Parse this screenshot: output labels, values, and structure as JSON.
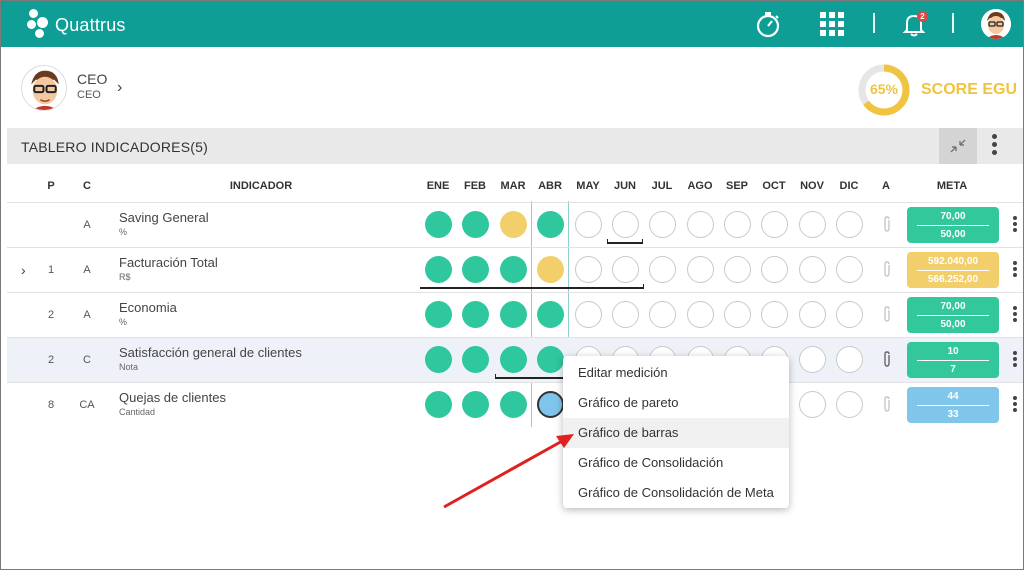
{
  "app": {
    "name": "Quattrus",
    "notification_count": "2"
  },
  "profile": {
    "name": "CEO",
    "role": "CEO"
  },
  "score": {
    "percent": "65%",
    "label": "SCORE EGU",
    "value": 0.65,
    "color": "#f0c341"
  },
  "board": {
    "title": "TABLERO INDICADORES(5)"
  },
  "table": {
    "headers": {
      "p": "P",
      "c": "C",
      "indicador": "INDICADOR",
      "a": "A",
      "meta": "META"
    },
    "months": [
      "ENE",
      "FEB",
      "MAR",
      "ABR",
      "MAY",
      "JUN",
      "JUL",
      "AGO",
      "SEP",
      "OCT",
      "NOV",
      "DIC"
    ],
    "rows": [
      {
        "p": "",
        "c": "A",
        "name": "Saving General",
        "unit": "%",
        "meta_top": "70,00",
        "meta_bottom": "50,00",
        "meta_color": "green",
        "statuses": [
          "green",
          "green",
          "yellow",
          "green",
          "empty",
          "empty",
          "empty",
          "empty",
          "empty",
          "empty",
          "empty",
          "empty"
        ]
      },
      {
        "p": "1",
        "c": "A",
        "name": "Facturación Total",
        "unit": "R$",
        "meta_top": "592.040,00",
        "meta_bottom": "566.252,00",
        "meta_color": "yellow",
        "statuses": [
          "green",
          "green",
          "green",
          "yellow",
          "empty",
          "empty",
          "empty",
          "empty",
          "empty",
          "empty",
          "empty",
          "empty"
        ]
      },
      {
        "p": "2",
        "c": "A",
        "name": "Economia",
        "unit": "%",
        "meta_top": "70,00",
        "meta_bottom": "50,00",
        "meta_color": "green",
        "statuses": [
          "green",
          "green",
          "green",
          "green",
          "empty",
          "empty",
          "empty",
          "empty",
          "empty",
          "empty",
          "empty",
          "empty"
        ]
      },
      {
        "p": "2",
        "c": "C",
        "name": "Satisfacción general de clientes",
        "unit": "Nota",
        "meta_top": "10",
        "meta_bottom": "7",
        "meta_color": "green",
        "statuses": [
          "green",
          "green",
          "green",
          "green",
          "empty",
          "empty",
          "empty",
          "empty",
          "empty",
          "empty",
          "empty",
          "empty"
        ]
      },
      {
        "p": "8",
        "c": "CA",
        "name": "Quejas de clientes",
        "unit": "Cantidad",
        "meta_top": "44",
        "meta_bottom": "33",
        "meta_color": "blue",
        "statuses": [
          "green",
          "green",
          "green",
          "blue",
          "empty",
          "empty",
          "empty",
          "empty",
          "empty",
          "empty",
          "empty",
          "empty"
        ]
      }
    ]
  },
  "context_menu": {
    "items": [
      "Editar medición",
      "Gráfico de pareto",
      "Gráfico de barras",
      "Gráfico de Consolidación",
      "Gráfico de Consolidación de Meta"
    ],
    "active_item": "Gráfico de barras"
  },
  "colors": {
    "brand": "#0e9e96",
    "green": "#2fc79d",
    "yellow": "#f2cf6b",
    "blue": "#7fc4ea",
    "annotation_arrow": "#e02020"
  },
  "icons": [
    "logo-icon",
    "stopwatch-icon",
    "apps-grid-icon",
    "bell-icon",
    "avatar",
    "chevron-right-icon",
    "collapse-icon",
    "kebab-menu-icon",
    "paperclip-icon",
    "expand-row-icon"
  ]
}
